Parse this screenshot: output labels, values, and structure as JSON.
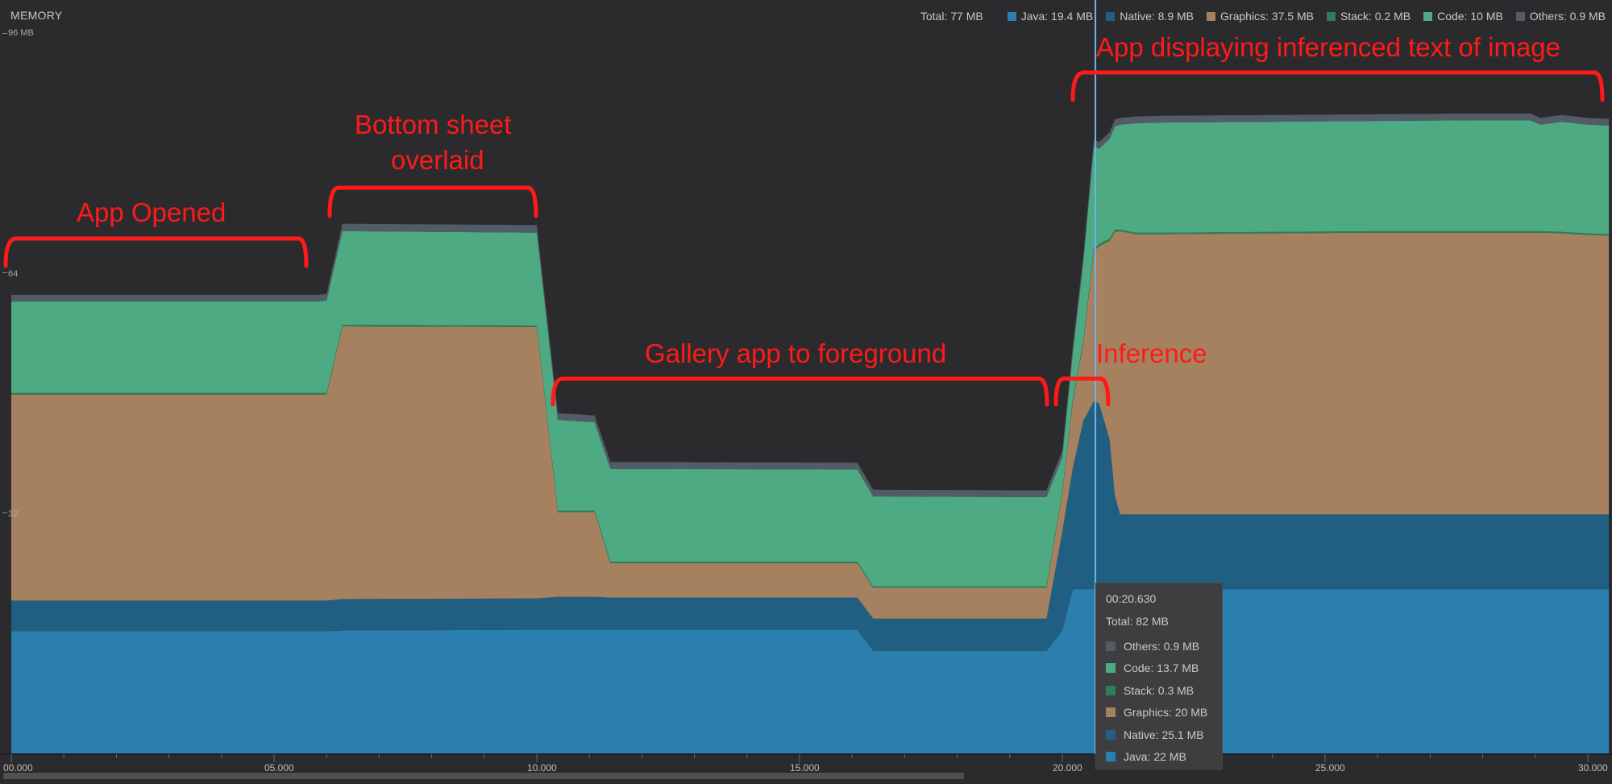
{
  "panel": {
    "title": "MEMORY"
  },
  "legend": {
    "total": "Total: 77 MB",
    "items": [
      {
        "label": "Java: 19.4 MB",
        "color": "#2b7fae"
      },
      {
        "label": "Native: 8.9 MB",
        "color": "#215f82"
      },
      {
        "label": "Graphics: 37.5 MB",
        "color": "#a6815f"
      },
      {
        "label": "Stack: 0.2 MB",
        "color": "#2e7d57"
      },
      {
        "label": "Code: 10 MB",
        "color": "#4eaa82"
      },
      {
        "label": "Others: 0.9 MB",
        "color": "#525c66"
      }
    ]
  },
  "y_axis": {
    "ticks": [
      {
        "label": "96 MB",
        "value": 96
      },
      {
        "label": "64",
        "value": 64
      },
      {
        "label": "32",
        "value": 32
      }
    ]
  },
  "x_axis": {
    "ticks": [
      "00.000",
      "05.000",
      "10.000",
      "15.000",
      "20.000",
      "25.000",
      "30.000"
    ]
  },
  "tooltip": {
    "time": "00:20.630",
    "total": "Total: 82 MB",
    "rows": [
      {
        "label": "Others: 0.9 MB",
        "color": "#525c66"
      },
      {
        "label": "Code: 13.7 MB",
        "color": "#4eaa82"
      },
      {
        "label": "Stack: 0.3 MB",
        "color": "#2e7d57"
      },
      {
        "label": "Graphics: 20 MB",
        "color": "#a6815f"
      },
      {
        "label": "Native: 25.1 MB",
        "color": "#215f82"
      },
      {
        "label": "Java: 22 MB",
        "color": "#2b7fae"
      }
    ]
  },
  "annotations": {
    "app_opened": "App Opened",
    "bottom_sheet": "Bottom sheet",
    "overlaid": "overlaid",
    "gallery": "Gallery app to foreground",
    "inference": "Inference",
    "displaying": "App displaying inferenced text of image"
  },
  "chart_data": {
    "type": "area",
    "stacked": true,
    "title": "MEMORY",
    "xlabel": "",
    "ylabel": "",
    "xlim": [
      0,
      30.4
    ],
    "ylim": [
      0,
      96
    ],
    "x": [
      0,
      5.8,
      6.0,
      6.3,
      10.0,
      10.4,
      11.1,
      11.4,
      16.1,
      16.4,
      19.7,
      20.0,
      20.2,
      20.4,
      20.6,
      20.7,
      20.9,
      21.0,
      21.1,
      21.4,
      22,
      24,
      26,
      28,
      28.9,
      29.1,
      29.5,
      30.0,
      30.4
    ],
    "series": [
      {
        "name": "Java",
        "color": "#2b7fae",
        "values": [
          16.4,
          16.4,
          16.4,
          16.5,
          16.6,
          16.6,
          16.6,
          16.6,
          16.6,
          13.8,
          13.8,
          16.5,
          22,
          22,
          22,
          22,
          22,
          22,
          22,
          22,
          22,
          22,
          22,
          22,
          22,
          22,
          22,
          22,
          22
        ]
      },
      {
        "name": "Native",
        "color": "#215f82",
        "values": [
          4.1,
          4.1,
          4.1,
          4.2,
          4.2,
          4.4,
          4.4,
          4.3,
          4.3,
          4.3,
          4.3,
          13.2,
          16.2,
          22.5,
          25.1,
          24.8,
          20,
          12.5,
          10,
          10,
          10,
          10,
          10,
          10,
          10,
          10,
          10,
          10,
          10
        ]
      },
      {
        "name": "Graphics",
        "color": "#a6815f",
        "values": [
          27.5,
          27.5,
          27.5,
          36.4,
          36.2,
          11.3,
          11.3,
          4.6,
          4.6,
          4.1,
          4.1,
          5.2,
          8.8,
          10.4,
          20,
          21,
          26.5,
          35.2,
          37.8,
          37.4,
          37.4,
          37.5,
          37.6,
          37.6,
          37.6,
          37.6,
          37.5,
          37.3,
          37.2
        ]
      },
      {
        "name": "Stack",
        "color": "#2e7d57",
        "values": [
          0.2,
          0.2,
          0.2,
          0.2,
          0.2,
          0.2,
          0.2,
          0.2,
          0.2,
          0.2,
          0.2,
          0.2,
          0.3,
          0.3,
          0.3,
          0.3,
          0.3,
          0.3,
          0.2,
          0.2,
          0.2,
          0.2,
          0.2,
          0.2,
          0.2,
          0.2,
          0.2,
          0.2,
          0.2
        ]
      },
      {
        "name": "Code",
        "color": "#4eaa82",
        "values": [
          12.2,
          12.2,
          12.3,
          12.5,
          12.4,
          12.1,
          11.8,
          12.4,
          12.3,
          12.0,
          11.9,
          4.5,
          6.2,
          10.5,
          13.7,
          12.7,
          13.3,
          13.8,
          14.0,
          14.6,
          14.7,
          14.7,
          14.7,
          14.8,
          14.8,
          14.2,
          14.7,
          14.5,
          14.5
        ]
      },
      {
        "name": "Others",
        "color": "#525c66",
        "values": [
          0.9,
          0.9,
          0.9,
          1.0,
          1.0,
          0.9,
          0.9,
          0.9,
          0.9,
          0.9,
          0.9,
          0.9,
          0.9,
          0.9,
          0.9,
          0.9,
          0.9,
          0.9,
          0.9,
          0.9,
          0.9,
          0.9,
          0.9,
          0.9,
          0.9,
          0.9,
          0.9,
          0.9,
          0.9
        ]
      }
    ],
    "cursor_x": 20.63,
    "legend": "top-right"
  }
}
